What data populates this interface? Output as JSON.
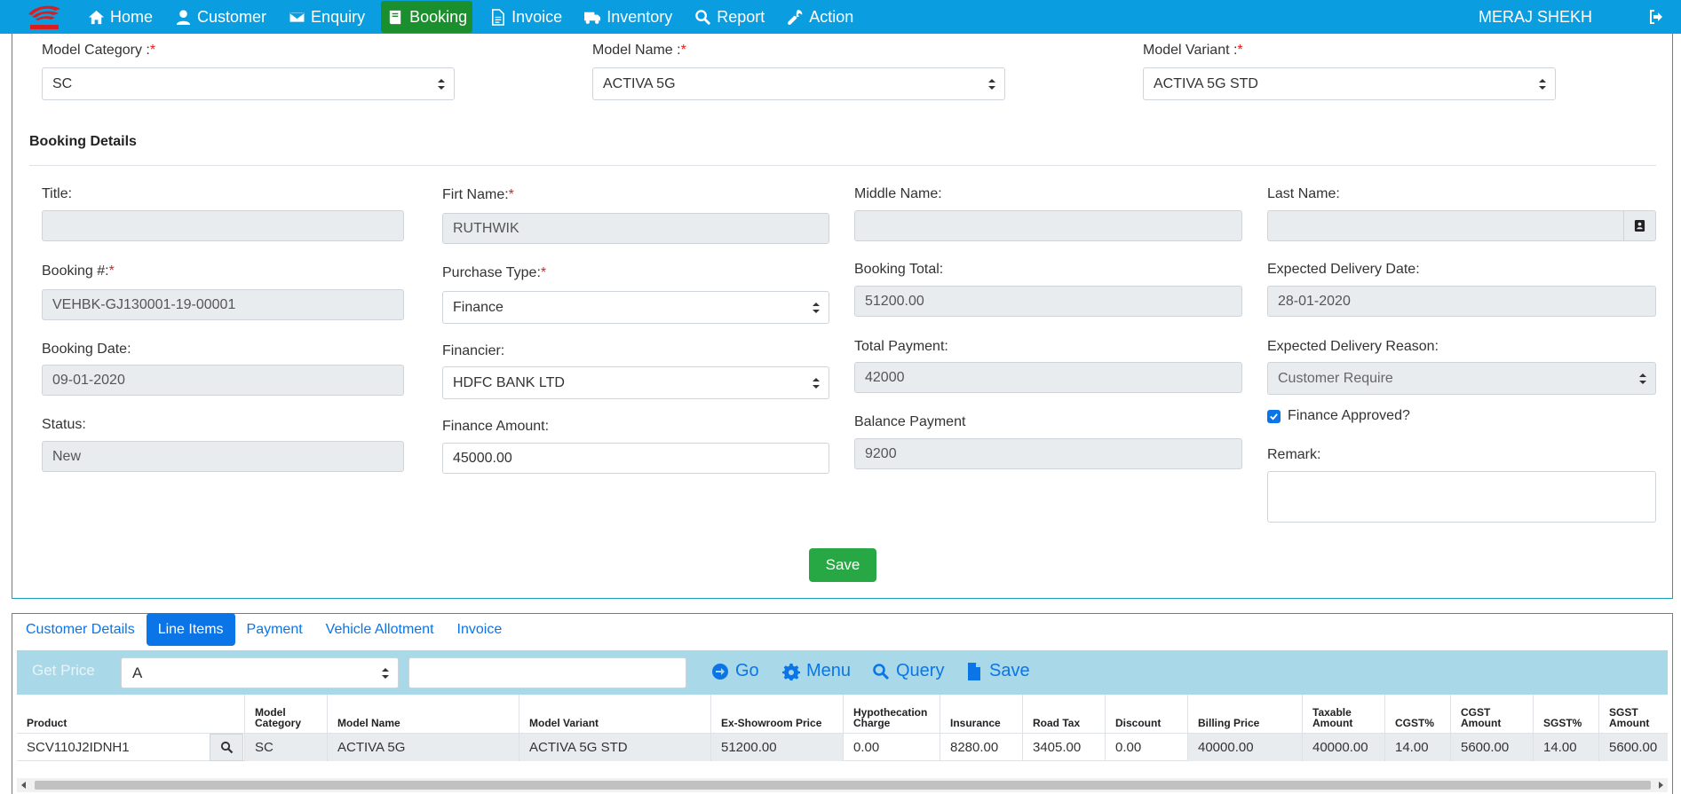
{
  "nav": {
    "items": [
      {
        "label": "Home",
        "icon": "home-icon"
      },
      {
        "label": "Customer",
        "icon": "user-icon"
      },
      {
        "label": "Enquiry",
        "icon": "envelope-icon"
      },
      {
        "label": "Booking",
        "icon": "book-icon"
      },
      {
        "label": "Invoice",
        "icon": "file-icon"
      },
      {
        "label": "Inventory",
        "icon": "truck-icon"
      },
      {
        "label": "Report",
        "icon": "search-icon"
      },
      {
        "label": "Action",
        "icon": "wrench-icon"
      }
    ],
    "active": "Booking",
    "user": "MERAJ SHEKH",
    "brand_color": "#0a9ee0",
    "active_color": "#1b8f2e"
  },
  "model": {
    "category_label": "Model Category :",
    "category_value": "SC",
    "name_label": "Model Name :",
    "name_value": "ACTIVA 5G",
    "variant_label": "Model Variant :",
    "variant_value": "ACTIVA 5G STD"
  },
  "booking": {
    "section_title": "Booking Details",
    "title_label": "Title:",
    "title_value": "",
    "first_name_label": "Firt Name:",
    "first_name_value": "RUTHWIK",
    "middle_name_label": "Middle Name:",
    "middle_name_value": "",
    "last_name_label": "Last Name:",
    "last_name_value": "",
    "booking_no_label": "Booking #:",
    "booking_no_value": "VEHBK-GJ130001-19-00001",
    "purchase_type_label": "Purchase Type:",
    "purchase_type_value": "Finance",
    "booking_total_label": "Booking Total:",
    "booking_total_value": "51200.00",
    "expected_delivery_label": "Expected Delivery Date:",
    "expected_delivery_value": "28-01-2020",
    "booking_date_label": "Booking Date:",
    "booking_date_value": "09-01-2020",
    "financier_label": "Financier:",
    "financier_value": "HDFC BANK LTD",
    "total_payment_label": "Total Payment:",
    "total_payment_value": "42000",
    "delivery_reason_label": "Expected Delivery Reason:",
    "delivery_reason_value": "Customer Require",
    "status_label": "Status:",
    "status_value": "New",
    "finance_amount_label": "Finance Amount:",
    "finance_amount_value": "45000.00",
    "balance_label": "Balance Payment",
    "balance_value": "9200",
    "finance_approved_label": "Finance Approved?",
    "finance_approved": true,
    "remark_label": "Remark:",
    "save_label": "Save"
  },
  "tabs": [
    "Customer Details",
    "Line Items",
    "Payment",
    "Vehicle Allotment",
    "Invoice"
  ],
  "active_tab": "Line Items",
  "toolbar": {
    "get_price_label": "Get Price",
    "select_value": "A",
    "go_label": "Go",
    "menu_label": "Menu",
    "query_label": "Query",
    "save_label": "Save"
  },
  "table": {
    "headers": [
      "Product",
      "Model Category",
      "Model Name",
      "Model Variant",
      "Ex-Showroom Price",
      "Hypothecation Charge",
      "Insurance",
      "Road Tax",
      "Discount",
      "Billing Price",
      "Taxable Amount",
      "CGST%",
      "CGST Amount",
      "SGST%",
      "SGST Amount"
    ],
    "rows": [
      [
        "SCV110J2IDNH1",
        "SC",
        "ACTIVA 5G",
        "ACTIVA 5G STD",
        "51200.00",
        "0.00",
        "8280.00",
        "3405.00",
        "0.00",
        "40000.00",
        "40000.00",
        "14.00",
        "5600.00",
        "14.00",
        "5600.00"
      ]
    ]
  }
}
